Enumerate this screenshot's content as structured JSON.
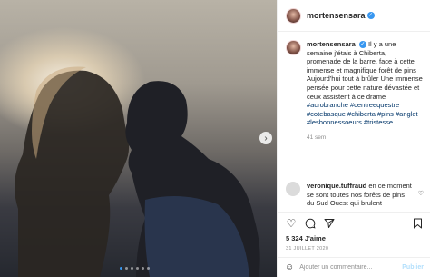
{
  "post": {
    "username": "mortensensara",
    "caption": "Il y a une semaine j'étais à Chiberta, promenade de la barre, face à cette immense et magnifique forêt de pins Aujourd'hui tout à brûler Une immense pensée pour cette nature dévastée et ceux assistent à ce drame",
    "hashtags": "#acrobranche #centreequestre #cotebasque #chiberta #pins #anglet #lesbonnessoeurs #tristesse",
    "time_ago": "41 sem"
  },
  "comment": {
    "username": "veronique.tuffraud",
    "text": "en ce moment se sont toutes nos forêts de pins du Sud Ouest qui brulent"
  },
  "likes": "5 324 J'aime",
  "date": "31 JUILLET 2020",
  "add_comment": {
    "placeholder": "Ajouter un commentaire...",
    "publish": "Publier"
  },
  "colors": {
    "link": "#003569",
    "verified": "#3897f0",
    "publish_disabled": "#b2dffc"
  }
}
